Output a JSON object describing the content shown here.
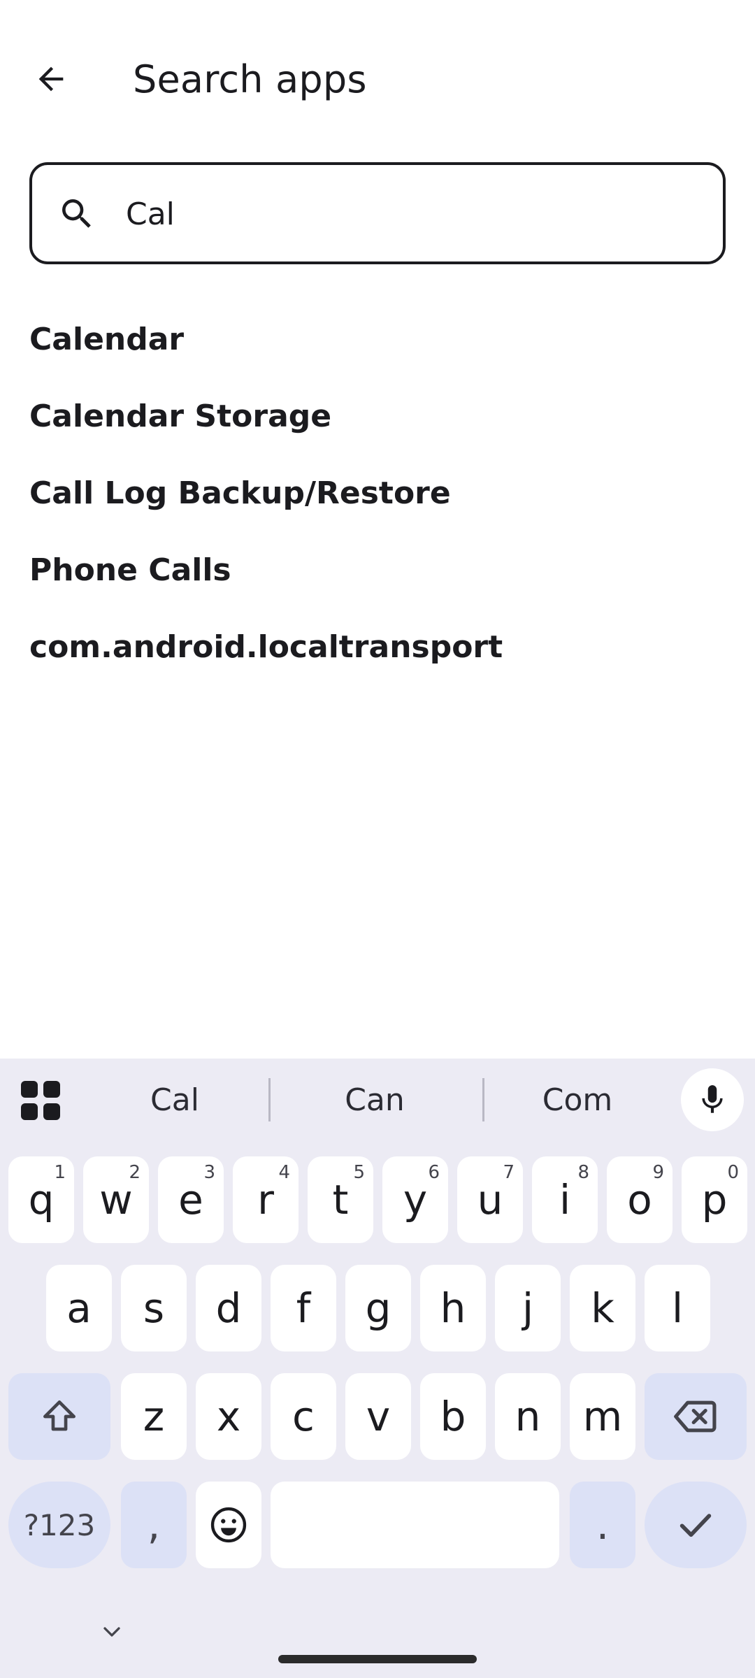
{
  "header": {
    "title": "Search apps"
  },
  "search": {
    "value": "Cal",
    "icon": "search-icon"
  },
  "results": [
    "Calendar",
    "Calendar Storage",
    "Call Log Backup/Restore",
    "Phone Calls",
    "com.android.localtransport"
  ],
  "keyboard": {
    "suggestions": [
      "Cal",
      "Can",
      "Com"
    ],
    "row1": [
      {
        "k": "q",
        "n": "1"
      },
      {
        "k": "w",
        "n": "2"
      },
      {
        "k": "e",
        "n": "3"
      },
      {
        "k": "r",
        "n": "4"
      },
      {
        "k": "t",
        "n": "5"
      },
      {
        "k": "y",
        "n": "6"
      },
      {
        "k": "u",
        "n": "7"
      },
      {
        "k": "i",
        "n": "8"
      },
      {
        "k": "o",
        "n": "9"
      },
      {
        "k": "p",
        "n": "0"
      }
    ],
    "row2": [
      "a",
      "s",
      "d",
      "f",
      "g",
      "h",
      "j",
      "k",
      "l"
    ],
    "row3": [
      "z",
      "x",
      "c",
      "v",
      "b",
      "n",
      "m"
    ],
    "symbols_label": "?123",
    "comma_label": ",",
    "period_label": ".",
    "colors": {
      "background": "#ecebf4",
      "modifier": "#dce1f6",
      "key": "#ffffff"
    }
  }
}
